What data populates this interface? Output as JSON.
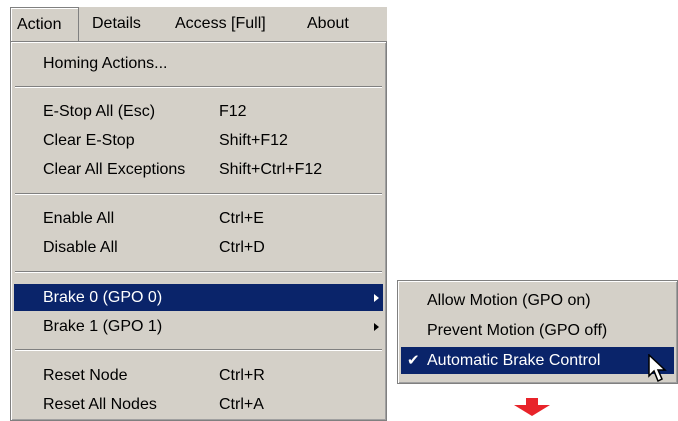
{
  "menubar": {
    "items": [
      {
        "label": "Action"
      },
      {
        "label": "Details"
      },
      {
        "label": "Access [Full]"
      },
      {
        "label": "About"
      }
    ]
  },
  "action_menu": {
    "homing": "Homing Actions...",
    "estop_all": {
      "label": "E-Stop All (Esc)",
      "shortcut": "F12"
    },
    "clear_estop": {
      "label": "Clear E-Stop",
      "shortcut": "Shift+F12"
    },
    "clear_exceptions": {
      "label": "Clear All Exceptions",
      "shortcut": "Shift+Ctrl+F12"
    },
    "enable_all": {
      "label": "Enable All",
      "shortcut": "Ctrl+E"
    },
    "disable_all": {
      "label": "Disable All",
      "shortcut": "Ctrl+D"
    },
    "brake0": {
      "label": "Brake 0 (GPO 0)"
    },
    "brake1": {
      "label": "Brake 1 (GPO 1)"
    },
    "reset_node": {
      "label": "Reset Node",
      "shortcut": "Ctrl+R"
    },
    "reset_all": {
      "label": "Reset All Nodes",
      "shortcut": "Ctrl+A"
    }
  },
  "brake_submenu": {
    "items": [
      {
        "label": "Allow Motion (GPO on)",
        "checked": false
      },
      {
        "label": "Prevent Motion (GPO off)",
        "checked": false
      },
      {
        "label": "Automatic Brake Control",
        "checked": true
      }
    ]
  },
  "colors": {
    "menu_bg": "#d4d0c8",
    "highlight": "#0a246a",
    "annotation_arrow": "#e8232a"
  },
  "icons": [
    "chevron-right-icon",
    "check-icon",
    "mouse-cursor-icon",
    "arrow-down-icon"
  ]
}
